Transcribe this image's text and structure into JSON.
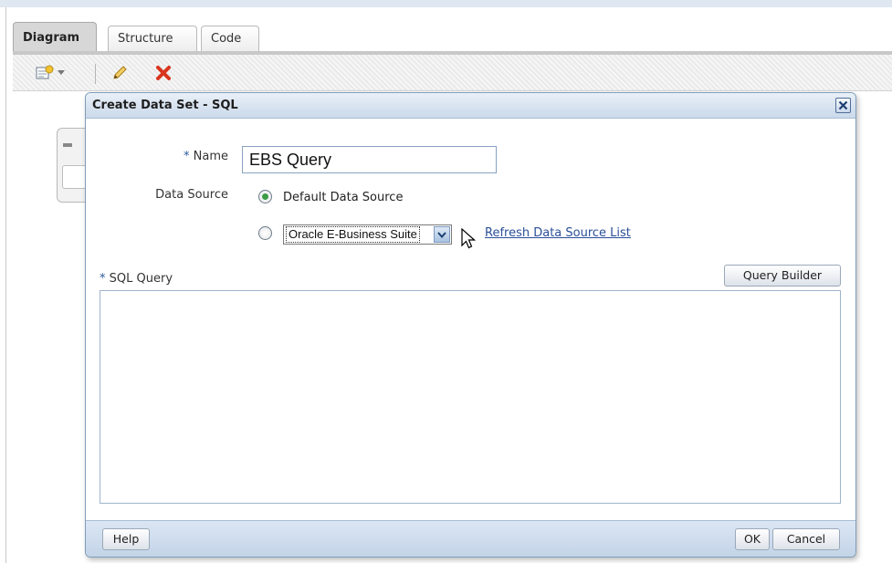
{
  "tabs": [
    {
      "label": "Diagram",
      "active": true
    },
    {
      "label": "Structure",
      "active": false
    },
    {
      "label": "Code",
      "active": false
    }
  ],
  "toolbar": {
    "icons": [
      "new-data-set-icon",
      "dropdown-arrow-icon",
      "edit-pencil-icon",
      "delete-x-icon"
    ]
  },
  "dialog": {
    "title": "Create Data Set - SQL",
    "name_required_mark": "*",
    "name_label": "Name",
    "name_value": "EBS Query",
    "data_source_label": "Data Source",
    "default_data_source_label": "Default Data Source",
    "default_selected": true,
    "data_source_select_value": "Oracle E-Business Suite",
    "refresh_link": "Refresh Data Source List",
    "sql_query_required_mark": "*",
    "sql_query_label": "SQL Query",
    "sql_query_value": "",
    "query_builder_button": "Query Builder",
    "help_button": "Help",
    "ok_button": "OK",
    "cancel_button": "Cancel"
  },
  "colors": {
    "dialog_border": "#7f9db9",
    "title_bar": "#cbd9ea",
    "link": "#2a4f99",
    "radio_selected": "#3b9c48",
    "delete_icon": "#d9341e"
  }
}
